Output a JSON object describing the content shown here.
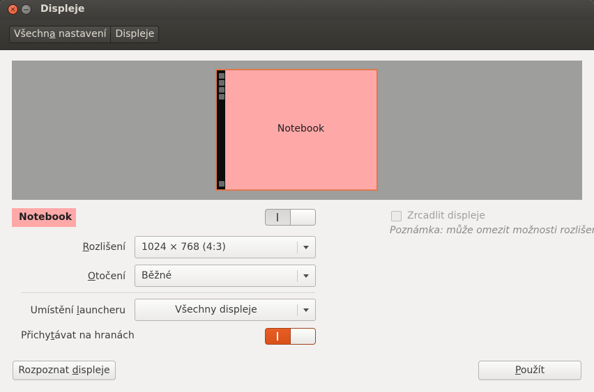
{
  "window": {
    "title": "Displeje"
  },
  "titlebar": {
    "close_glyph": "✕",
    "minimize_glyph": "−"
  },
  "breadcrumb": {
    "parent_pre": "Všechn",
    "parent_mnemonic": "a",
    "parent_post": " nastavení",
    "current": "Displeje"
  },
  "arrangement": {
    "monitor_label": "Notebook",
    "monitor_color": "#ffa8a8",
    "launcher_color": "#0c0c0c"
  },
  "display": {
    "name": "Notebook",
    "enabled": true
  },
  "mirror": {
    "label": "Zrcadlit displeje",
    "checked": false,
    "note": "Poznámka: může omezit možnosti rozlišení"
  },
  "resolution": {
    "label_mnemonic": "R",
    "label_rest": "ozlišení",
    "value": "1024 × 768 (4:3)"
  },
  "rotation": {
    "label_mnemonic": "O",
    "label_rest": "točení",
    "value": "Běžné"
  },
  "launcher": {
    "label_pre": "Umístění ",
    "label_mnemonic": "l",
    "label_post": "auncheru",
    "value": "Všechny displeje"
  },
  "sticky_edges": {
    "label_pre": "Přichy",
    "label_mnemonic": "t",
    "label_post": "ávat na hranách",
    "enabled": true
  },
  "buttons": {
    "detect_pre": "Rozpoznat ",
    "detect_mnemonic": "d",
    "detect_post": "ispleje",
    "apply_mnemonic": "P",
    "apply_rest": "oužít"
  },
  "colors": {
    "accent": "#e05d22",
    "display_tag": "#ffa8a8"
  }
}
